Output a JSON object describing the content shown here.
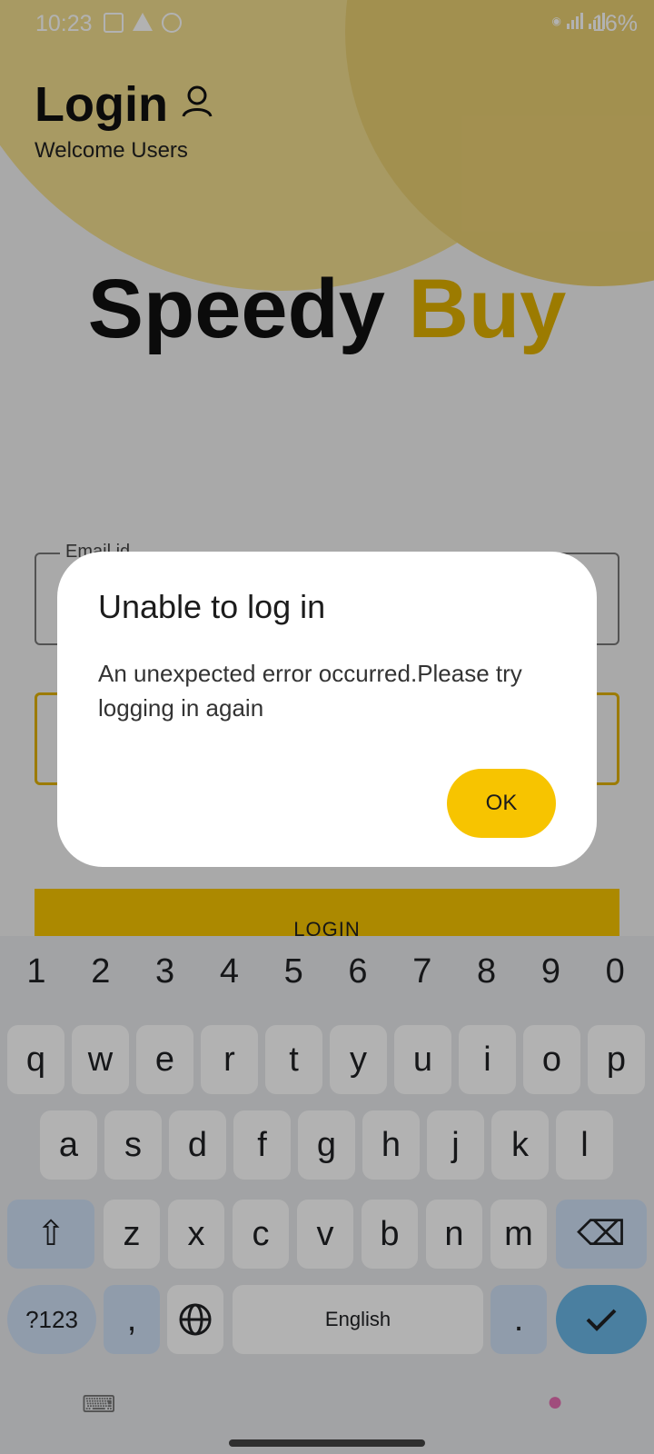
{
  "status_bar": {
    "time": "10:23",
    "battery": "16%"
  },
  "header": {
    "title": "Login",
    "subtitle": "Welcome Users"
  },
  "brand": {
    "part1": "Speedy",
    "part2": "Buy"
  },
  "form": {
    "email_label": "Email id",
    "login_button": "LOGIN"
  },
  "dialog": {
    "title": "Unable to log in",
    "message": "An unexpected error occurred.Please try logging in again",
    "ok_button": "OK"
  },
  "keyboard": {
    "numbers": [
      "1",
      "2",
      "3",
      "4",
      "5",
      "6",
      "7",
      "8",
      "9",
      "0"
    ],
    "row1": [
      "q",
      "w",
      "e",
      "r",
      "t",
      "y",
      "u",
      "i",
      "o",
      "p"
    ],
    "row2": [
      "a",
      "s",
      "d",
      "f",
      "g",
      "h",
      "j",
      "k",
      "l"
    ],
    "row3": [
      "z",
      "x",
      "c",
      "v",
      "b",
      "n",
      "m"
    ],
    "symbols_key": "?123",
    "comma": ",",
    "space_label": "English",
    "period": "."
  },
  "colors": {
    "accent": "#f7c400",
    "brand_yellow": "#e0b100",
    "done_key": "#6ab7e6"
  }
}
